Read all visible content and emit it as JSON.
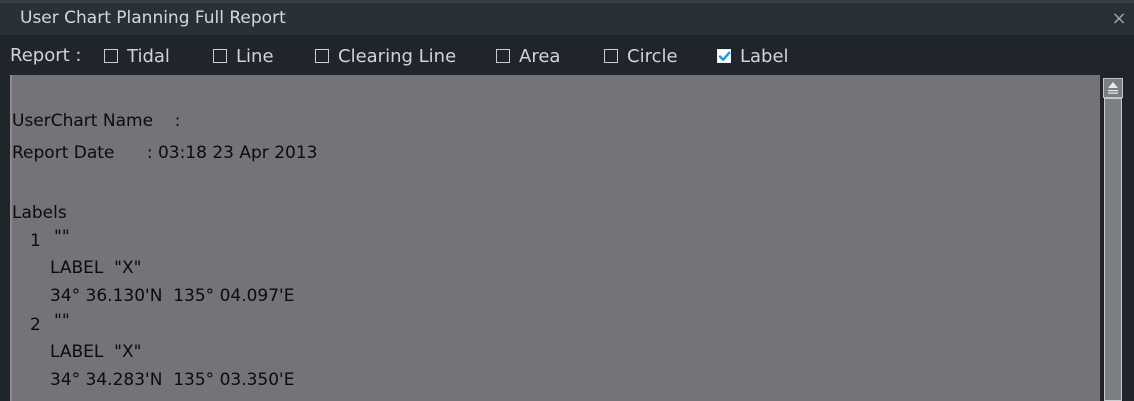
{
  "window": {
    "title": "User Chart Planning Full Report",
    "close_icon": "close-x-icon"
  },
  "report_bar": {
    "label": "Report :",
    "options": [
      {
        "label": "Tidal",
        "checked": false
      },
      {
        "label": "Line",
        "checked": false
      },
      {
        "label": "Clearing Line",
        "checked": false
      },
      {
        "label": "Area",
        "checked": false
      },
      {
        "label": "Circle",
        "checked": false
      },
      {
        "label": "Label",
        "checked": true
      }
    ]
  },
  "report": {
    "userchart_name": "UserChart Name    :",
    "report_date": "Report Date      : 03:18 23 Apr 2013",
    "labels_heading": "Labels",
    "entries": [
      {
        "index": "1",
        "name": "\"\"",
        "label": "LABEL  \"X\"",
        "position": "34° 36.130'N  135° 04.097'E"
      },
      {
        "index": "2",
        "name": "\"\"",
        "label": "LABEL  \"X\"",
        "position": "34° 34.283'N  135° 03.350'E"
      }
    ]
  },
  "colors": {
    "titlebar_bg": "#2a3038",
    "panel_bg": "#20252b",
    "content_bg": "#737378",
    "text_light": "#cfd4d9",
    "text_dark": "#0c0c0e",
    "checkbox_checked": "#1a9ad6"
  }
}
